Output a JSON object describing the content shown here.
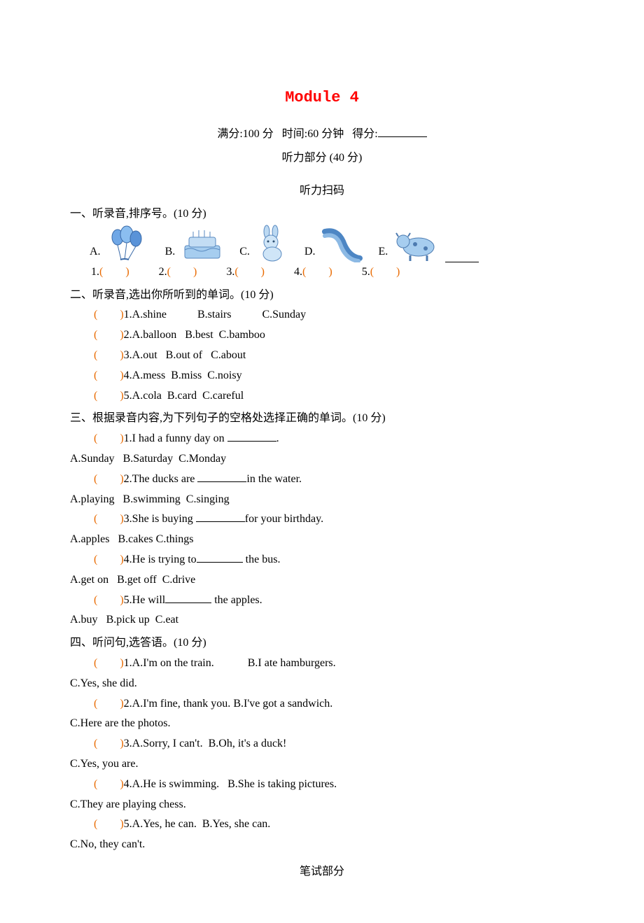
{
  "title": "Module 4",
  "meta": {
    "full_score_label": "满分:100 分",
    "time_label": "时间:60 分钟",
    "score_label": "得分:"
  },
  "listening_header": "听力部分 (40 分)",
  "scan_label": "听力扫码",
  "s1": {
    "head": "一、听录音,排序号。(10 分)",
    "labels": {
      "a": "A.",
      "b": "B.",
      "c": "C.",
      "d": "D.",
      "e": "E."
    },
    "nums": {
      "1": "1.",
      "2": "2.",
      "3": "3.",
      "4": "4.",
      "5": "5."
    },
    "paren": "(　　)"
  },
  "s2": {
    "head": "二、听录音,选出你所听到的单词。(10 分)",
    "paren": "(　　)",
    "items": [
      {
        "num": "1.",
        "a": "A.shine",
        "b": "B.stairs",
        "c": "C.Sunday"
      },
      {
        "num": "2.",
        "a": "A.balloon",
        "b": "B.best",
        "c": "C.bamboo"
      },
      {
        "num": "3.",
        "a": "A.out",
        "b": "B.out of",
        "c": "C.about"
      },
      {
        "num": "4.",
        "a": "A.mess",
        "b": "B.miss",
        "c": "C.noisy"
      },
      {
        "num": "5.",
        "a": "A.cola",
        "b": "B.card",
        "c": "C.careful"
      }
    ]
  },
  "s3": {
    "head": "三、根据录音内容,为下列句子的空格处选择正确的单词。(10 分)",
    "paren": "(　　)",
    "items": [
      {
        "num": "1.",
        "pre": "I had a funny day on ",
        "post": ".",
        "opts": {
          "a": "A.Sunday",
          "b": "B.Saturday",
          "c": "C.Monday"
        }
      },
      {
        "num": "2.",
        "pre": "The ducks are ",
        "post": "in the water.",
        "opts": {
          "a": "A.playing",
          "b": "B.swimming",
          "c": "C.singing"
        }
      },
      {
        "num": "3.",
        "pre": "She is buying ",
        "post": "for your birthday.",
        "opts": {
          "a": "A.apples",
          "b": "B.cakes",
          "c": "C.things"
        }
      },
      {
        "num": "4.",
        "pre": "He is trying to",
        "post": " the bus.",
        "opts": {
          "a": "A.get on",
          "b": "B.get off",
          "c": "C.drive"
        }
      },
      {
        "num": "5.",
        "pre": "He will",
        "post": " the apples.",
        "opts": {
          "a": "A.buy",
          "b": "B.pick up",
          "c": "C.eat"
        }
      }
    ]
  },
  "s4": {
    "head": "四、听问句,选答语。(10 分)",
    "paren": "(　　)",
    "items": [
      {
        "num": "1.",
        "a": "A.I'm on the train.",
        "b": "B.I ate hamburgers.",
        "c": "C.Yes, she did."
      },
      {
        "num": "2.",
        "a": "A.I'm fine, thank you.",
        "b": "B.I've got a sandwich.",
        "c": "C.Here are the photos."
      },
      {
        "num": "3.",
        "a": "A.Sorry, I can't.",
        "b": "B.Oh, it's a duck!",
        "c": "C.Yes, you are."
      },
      {
        "num": "4.",
        "a": "A.He is swimming.",
        "b": "B.She is taking pictures.",
        "c": "C.They are playing chess."
      },
      {
        "num": "5.",
        "a": "A.Yes, he can.",
        "b": "B.Yes, she can.",
        "c": "C.No, they can't."
      }
    ]
  },
  "written_header": "笔试部分"
}
